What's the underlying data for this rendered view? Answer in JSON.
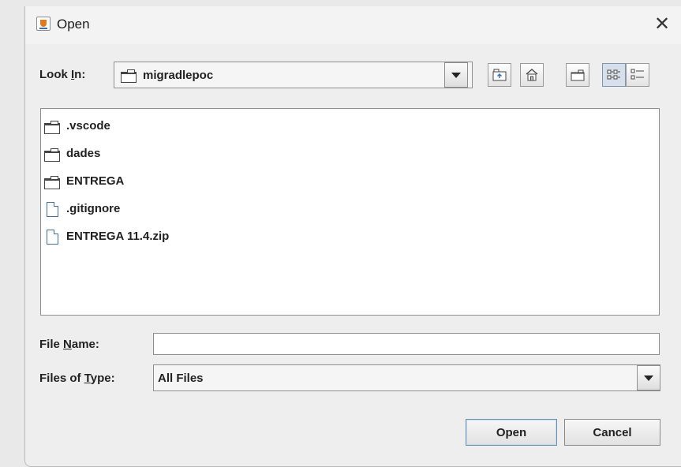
{
  "window": {
    "title": "Open",
    "close_glyph": "✕"
  },
  "lookin": {
    "label_pre": "Look ",
    "label_mnemonic": "I",
    "label_post": "n:",
    "value": "migradlepoc"
  },
  "toolbar": {
    "icons": [
      "up-one-level-icon",
      "home-icon",
      "new-folder-icon",
      "list-view-icon",
      "details-view-icon"
    ],
    "active": "list-view-icon"
  },
  "files": [
    {
      "name": ".vscode",
      "type": "folder"
    },
    {
      "name": "dades",
      "type": "folder"
    },
    {
      "name": "ENTREGA",
      "type": "folder"
    },
    {
      "name": ".gitignore",
      "type": "file"
    },
    {
      "name": "ENTREGA 11.4.zip",
      "type": "file"
    }
  ],
  "filename": {
    "label_pre": "File ",
    "label_mnemonic": "N",
    "label_post": "ame:",
    "value": ""
  },
  "filetype": {
    "label_pre": "Files of ",
    "label_mnemonic": "T",
    "label_post": "ype:",
    "value": "All Files"
  },
  "buttons": {
    "open": "Open",
    "cancel": "Cancel"
  }
}
